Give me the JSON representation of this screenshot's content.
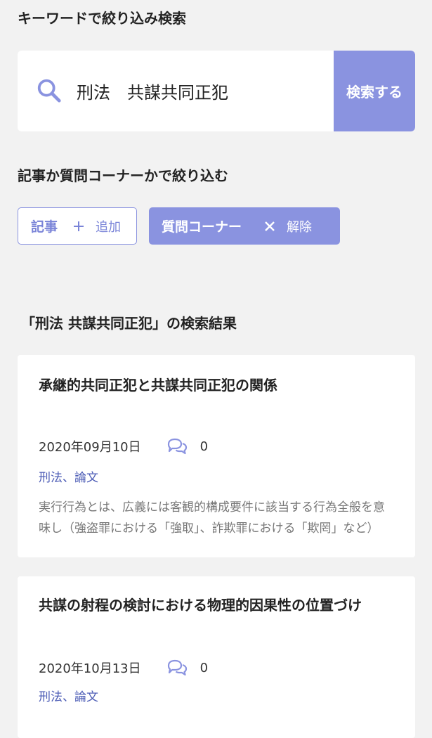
{
  "keyword_section": {
    "title": "キーワードで絞り込み検索"
  },
  "search": {
    "value": "刑法　共謀共同正犯",
    "button_label": "検索する"
  },
  "filter_section": {
    "title": "記事か質問コーナーかで絞り込む",
    "chips": [
      {
        "label": "記事",
        "action_label": "追加",
        "selected": false
      },
      {
        "label": "質問コーナー",
        "action_label": "解除",
        "selected": true
      }
    ]
  },
  "results": {
    "heading": "「刑法 共謀共同正犯」の検索結果",
    "items": [
      {
        "title": "承継的共同正犯と共謀共同正犯の関係",
        "date": "2020年09月10日",
        "comment_count": "0",
        "tags": "刑法、論文",
        "excerpt": "実行行為とは、広義には客観的構成要件に該当する行為全般を意味し（強盗罪における「強取」、詐欺罪における「欺罔」など）"
      },
      {
        "title": "共謀の射程の検討における物理的因果性の位置づけ",
        "date": "2020年10月13日",
        "comment_count": "0",
        "tags": "刑法、論文"
      }
    ]
  },
  "colors": {
    "accent": "#8a93e0",
    "tag_link": "#4b5bb5",
    "background": "#f2f2f2"
  },
  "icons": {
    "search": "search-icon",
    "comment": "comment-bubbles-icon",
    "add": "plus-icon",
    "remove": "close-icon"
  }
}
